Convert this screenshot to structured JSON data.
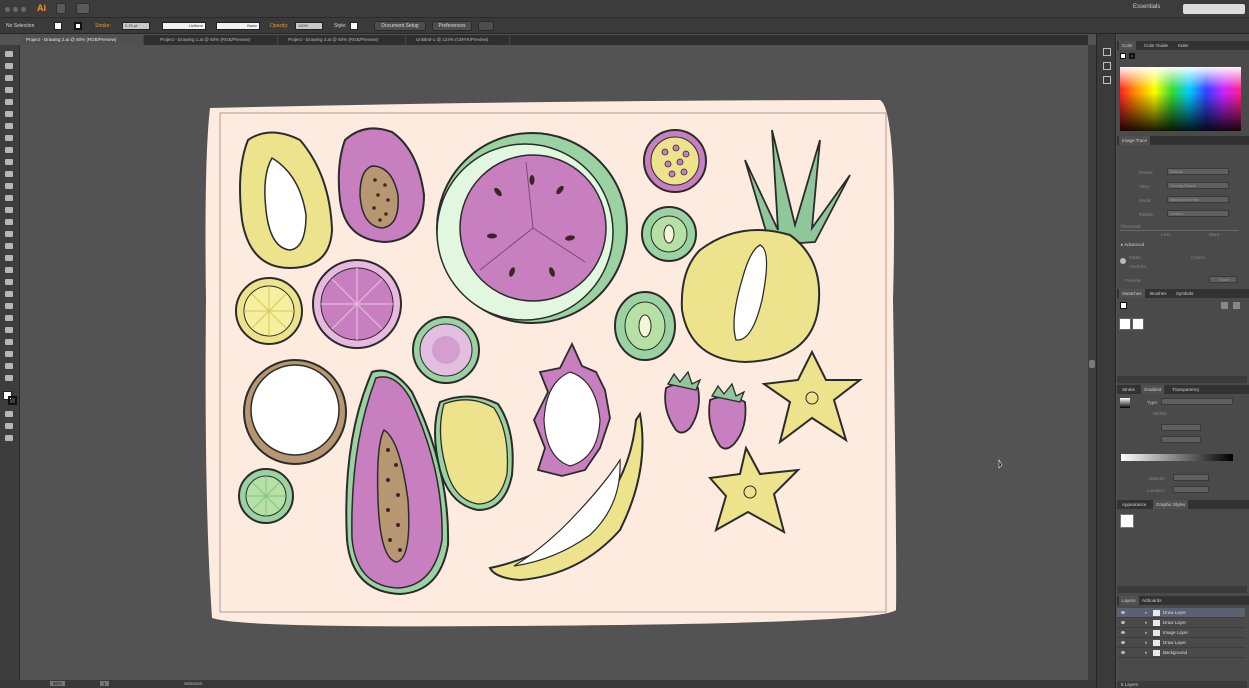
{
  "app": {
    "logo": "Ai",
    "workspace": "Essentials",
    "search_placeholder": ""
  },
  "control_bar": {
    "selection_state": "No Selection",
    "stroke_label": "Stroke:",
    "stroke_weight": "0.25 pt",
    "stroke_profile": "Uniform",
    "brush": "Basic",
    "opacity_label": "Opacity:",
    "opacity_value": "100%",
    "style_label": "Style:",
    "document_setup": "Document Setup",
    "preferences": "Preferences"
  },
  "doc_tabs": [
    "Project - Drawing 2.ai @ 50% (RGB/Preview)",
    "Project - Drawing 1.ai @ 50% (RGB/Preview)",
    "Project - Drawing 3.ai @ 50% (RGB/Preview)",
    "Untitled-1 @ 124% (CMYK/Preview)"
  ],
  "status_bar": {
    "zoom": "50%",
    "page": "1",
    "tool": "Selection"
  },
  "panels": {
    "color_tabs": [
      "Color",
      "Color Guide",
      "Kuler"
    ],
    "image_trace": {
      "title": "Image Trace",
      "labels": [
        "Preset:",
        "View:",
        "Mode:",
        "Palette:",
        "Threshold:",
        "Less",
        "More",
        "Advanced",
        "Paths:",
        "Colors:",
        "Anchors:",
        "Preview",
        "Trace"
      ],
      "values": [
        "Default",
        "Tracing Result",
        "Black and White",
        "Limited"
      ]
    },
    "swatch_tabs": [
      "Swatches",
      "Brushes",
      "Symbols"
    ],
    "gradient_tabs": [
      "Stroke",
      "Gradient",
      "Transparency"
    ],
    "gradient_labels": [
      "Type:",
      "Stroke:",
      "Opacity:",
      "Location:"
    ],
    "appearance_tabs": [
      "Appearance",
      "Graphic Styles"
    ],
    "layers_tabs": [
      "Layers",
      "Artboards"
    ],
    "layers": [
      {
        "name": "Draw Layer",
        "selected": true
      },
      {
        "name": "Draw Layer",
        "selected": false
      },
      {
        "name": "Image Layer",
        "selected": false
      },
      {
        "name": "Draw Layer",
        "selected": false
      },
      {
        "name": "Background",
        "selected": false
      }
    ],
    "layers_count": "5 Layers"
  },
  "colors": {
    "paper": "#fdebe0",
    "pink": "#c77fbf",
    "yellow": "#ece38c",
    "green": "#9ad2a1",
    "mint": "#e2f7e0",
    "seed": "#4a2b2b"
  }
}
